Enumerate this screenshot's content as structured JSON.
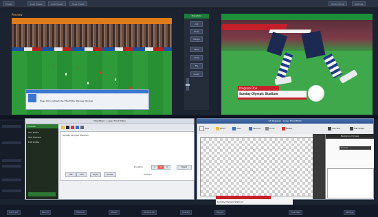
{
  "top_bar": {
    "buttons": [
      "Preset",
      "Load Preset",
      "Load Preset",
      "Save Preset"
    ],
    "right_buttons": [
      "Studio Mode",
      "Settings"
    ]
  },
  "left_monitor": {
    "title": "Preview",
    "dialog": {
      "title": "Information",
      "message": "Press OK to refresh the Title Editor Preview Window"
    }
  },
  "control_column": {
    "header": "Transition",
    "buttons": [
      "Cut",
      "Fade",
      "Merge",
      "Wipe",
      "Slide",
      "Fly",
      "Zoom"
    ]
  },
  "right_monitor": {
    "name": "Program One",
    "title": "Sunday Olympic Stadium"
  },
  "title_editor": {
    "window_title": "Title Editor - Lower Third Editor",
    "side_header": "Preview",
    "side_items": [
      "Text Editor",
      "Text Preview",
      "Edit Profile"
    ],
    "editor_text": "Sunday Olympic Stadium",
    "row1_label": "Duration",
    "row1_buttons": [
      "1",
      "2",
      "3",
      "Reset"
    ],
    "row2_label": "Preview",
    "row2_buttons": [
      "Left",
      "Mid",
      "Right",
      "Center"
    ]
  },
  "gt_designer": {
    "window_title": "GT Designer - Lower Third Editor",
    "tools": [
      "New",
      "Open",
      "Save",
      "Save As",
      "Undo",
      "Delete"
    ],
    "right_tools": [
      "Add Text",
      "Edit Shape"
    ],
    "panel_header": "Background Image",
    "dropdown": "Normal",
    "lower_third_text": "Sunday Olympic Stadium"
  },
  "bottom_bar": {
    "buttons": [
      "Add Input",
      "Record",
      "External",
      "Stream",
      "MultiCorder",
      "Overlay",
      "Playlist",
      "Fullscreen",
      "Settings"
    ]
  },
  "colors": {
    "accent_green": "#1d8f3a",
    "accent_orange": "#e07b1a",
    "lower_third_red": "#c8202b"
  }
}
